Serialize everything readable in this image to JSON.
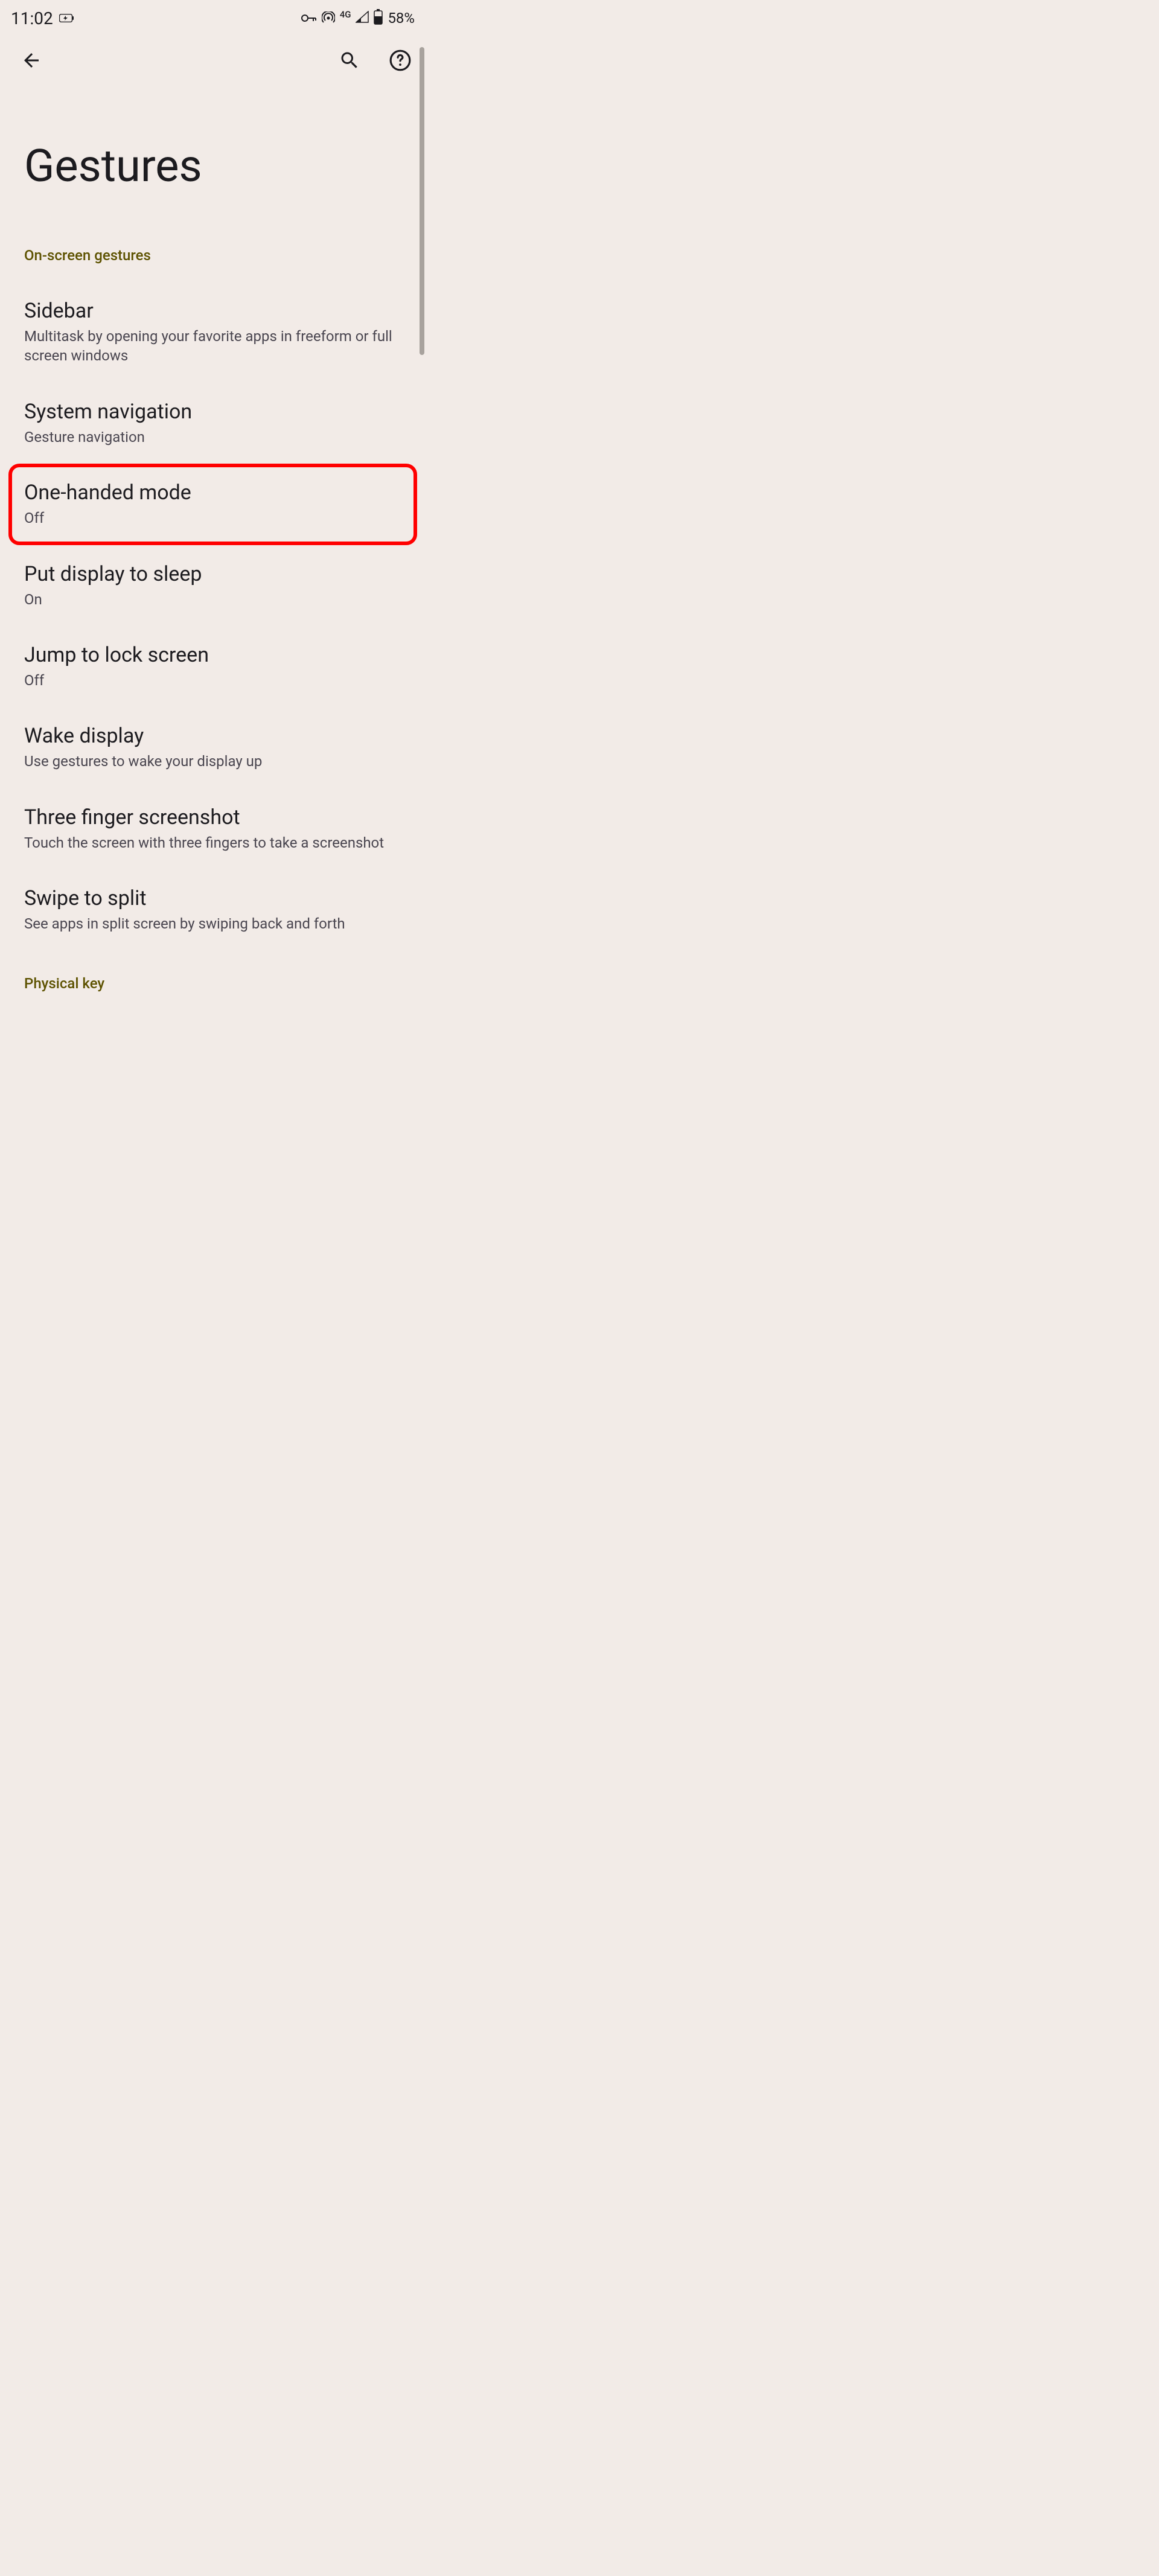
{
  "status_bar": {
    "time": "11:02",
    "network_label": "4G",
    "battery_text": "58%"
  },
  "page": {
    "title": "Gestures"
  },
  "sections": [
    {
      "header": "On-screen gestures",
      "items": [
        {
          "title": "Sidebar",
          "subtitle": "Multitask by opening your favorite apps in freeform or full screen windows",
          "highlighted": false
        },
        {
          "title": "System navigation",
          "subtitle": "Gesture navigation",
          "highlighted": false
        },
        {
          "title": "One-handed mode",
          "subtitle": "Off",
          "highlighted": true
        },
        {
          "title": "Put display to sleep",
          "subtitle": "On",
          "highlighted": false
        },
        {
          "title": "Jump to lock screen",
          "subtitle": "Off",
          "highlighted": false
        },
        {
          "title": "Wake display",
          "subtitle": "Use gestures to wake your display up",
          "highlighted": false
        },
        {
          "title": "Three finger screenshot",
          "subtitle": "Touch the screen with three fingers to take a screenshot",
          "highlighted": false
        },
        {
          "title": "Swipe to split",
          "subtitle": "See apps in split screen by swiping back and forth",
          "highlighted": false
        }
      ]
    },
    {
      "header": "Physical key",
      "items": []
    }
  ]
}
